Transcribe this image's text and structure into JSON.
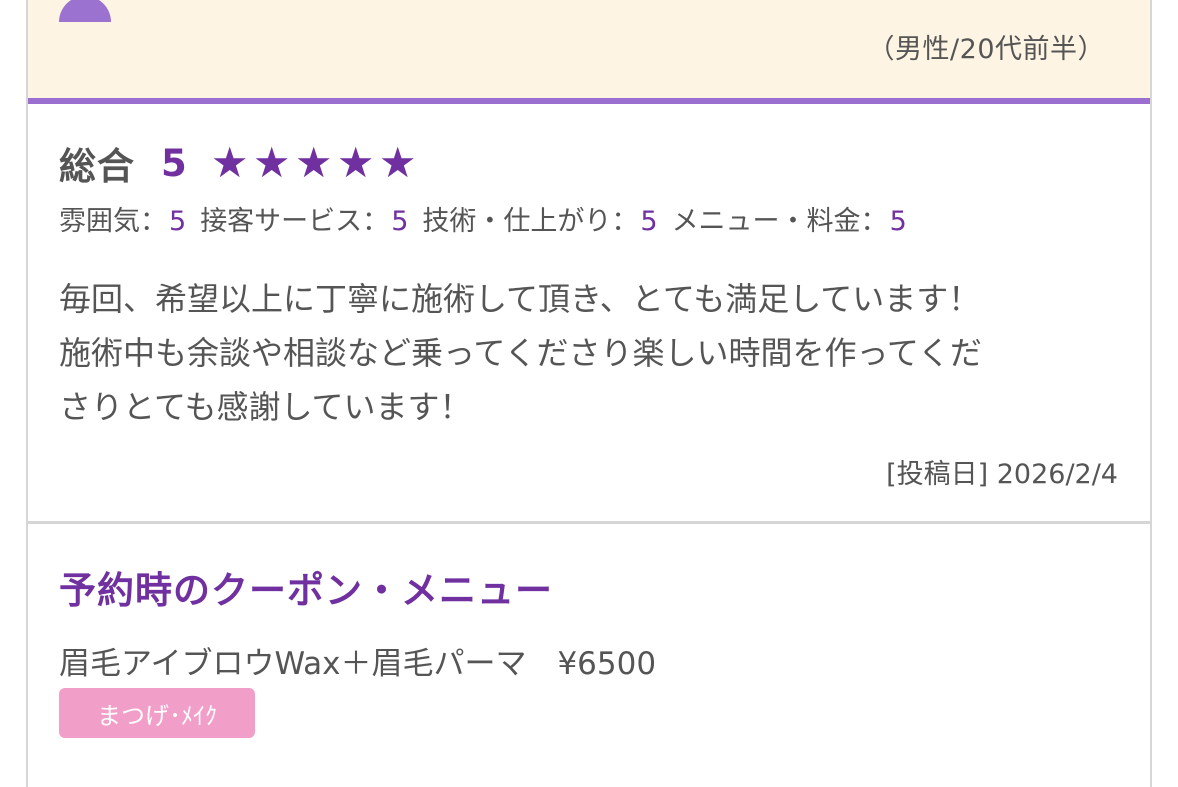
{
  "reviewer": {
    "meta": "（男性/20代前半）",
    "avatar_icon": "person-icon"
  },
  "rating": {
    "overall_label": "総合",
    "overall_score": "5",
    "stars": [
      1,
      2,
      3,
      4,
      5
    ],
    "star_glyph": "★",
    "star_color": "#7030a0",
    "sub": [
      {
        "label": "雰囲気：",
        "value": "5"
      },
      {
        "label": "接客サービス：",
        "value": "5"
      },
      {
        "label": "技術・仕上がり：",
        "value": "5"
      },
      {
        "label": "メニュー・料金：",
        "value": "5"
      }
    ]
  },
  "comment": {
    "text": "毎回、希望以上に丁寧に施術して頂き、とても満足しています！\n施術中も余談や相談など乗ってくださり楽しい時間を作ってくだ\nさりとても感謝しています！"
  },
  "post_date": "[投稿日] 2026/2/4",
  "coupon": {
    "section_title": "予約時のクーポン・メニュー",
    "name": "眉毛アイブロウWax＋眉毛パーマ　¥6500",
    "tag": "まつげ･ﾒｲｸ"
  },
  "colors": {
    "accent": "#7030a0",
    "rule": "#9b6fd0",
    "reviewer_bg": "#fdf4e3",
    "tag_bg": "#f19ec8"
  }
}
